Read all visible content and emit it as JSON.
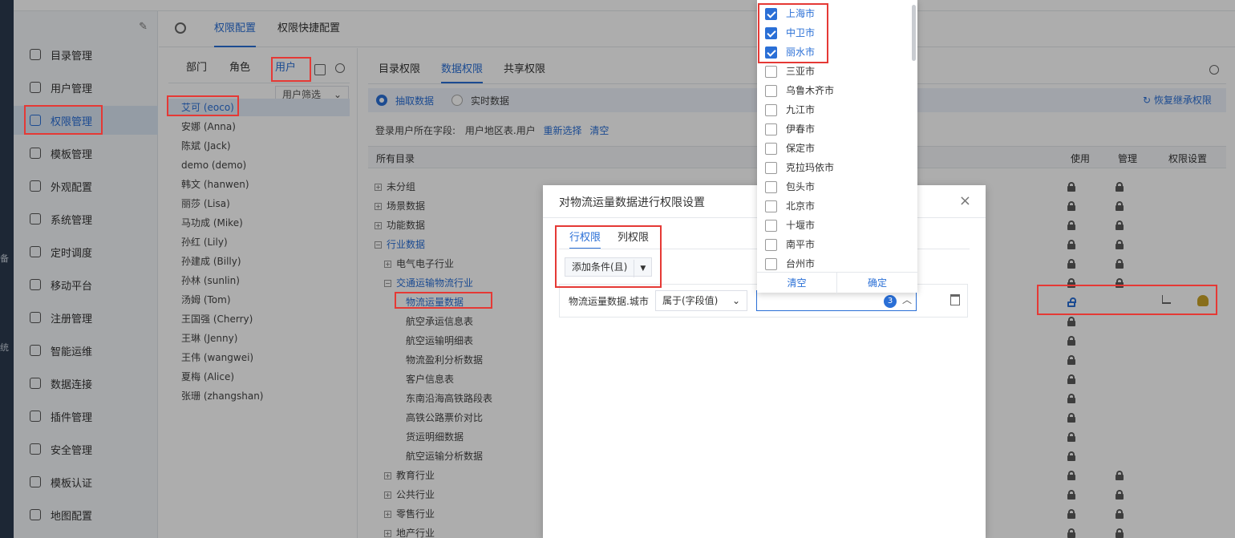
{
  "left_rail": {
    "fragments": [
      "备",
      "统"
    ]
  },
  "sidebar": {
    "pin_icon": "pin-icon",
    "items": [
      {
        "label": "目录管理",
        "icon": "catalog-icon"
      },
      {
        "label": "用户管理",
        "icon": "user-icon"
      },
      {
        "label": "权限管理",
        "icon": "lock-icon",
        "active": true
      },
      {
        "label": "模板管理",
        "icon": "template-icon"
      },
      {
        "label": "外观配置",
        "icon": "appearance-icon"
      },
      {
        "label": "系统管理",
        "icon": "gear-icon"
      },
      {
        "label": "定时调度",
        "icon": "clock-icon"
      },
      {
        "label": "移动平台",
        "icon": "mobile-icon"
      },
      {
        "label": "注册管理",
        "icon": "register-icon"
      },
      {
        "label": "智能运维",
        "icon": "ops-icon"
      },
      {
        "label": "数据连接",
        "icon": "link-icon"
      },
      {
        "label": "插件管理",
        "icon": "plugin-icon"
      },
      {
        "label": "安全管理",
        "icon": "shield-icon"
      },
      {
        "label": "模板认证",
        "icon": "cert-icon"
      },
      {
        "label": "地图配置",
        "icon": "map-icon"
      }
    ]
  },
  "header": {
    "tabs": [
      "权限配置",
      "权限快捷配置"
    ],
    "active_tab": 0
  },
  "user_panel": {
    "tabs": [
      "部门",
      "角色",
      "用户"
    ],
    "active_tab": 2,
    "filter_label": "用户筛选",
    "users": [
      "艾可 (eoco)",
      "安娜 (Anna)",
      "陈斌 (Jack)",
      "demo (demo)",
      "韩文 (hanwen)",
      "丽莎 (Lisa)",
      "马功成 (Mike)",
      "孙红 (Lily)",
      "孙建成 (Billy)",
      "孙林 (sunlin)",
      "汤姆 (Tom)",
      "王国强 (Cherry)",
      "王琳 (Jenny)",
      "王伟 (wangwei)",
      "夏梅 (Alice)",
      "张珊 (zhangshan)"
    ],
    "selected_user": 0
  },
  "main_panel": {
    "tabs": [
      "目录权限",
      "数据权限",
      "共享权限"
    ],
    "active_tab": 1,
    "modes": [
      "抽取数据",
      "实时数据"
    ],
    "active_mode": 0,
    "restore_label": "恢复继承权限",
    "login_field_label": "登录用户所在字段:",
    "login_field_value": "用户地区表.用户",
    "reselect_label": "重新选择",
    "clear_label": "清空",
    "table_header": {
      "catalog": "所有目录",
      "use": "使用",
      "manage": "管理",
      "perm_settings": "权限设置"
    },
    "tree": [
      {
        "label": "未分组",
        "level": 0,
        "expand": "+",
        "use": "lock",
        "manage": "lock"
      },
      {
        "label": "场景数据",
        "level": 0,
        "expand": "+",
        "use": "lock",
        "manage": "lock"
      },
      {
        "label": "功能数据",
        "level": 0,
        "expand": "+",
        "use": "lock",
        "manage": "lock"
      },
      {
        "label": "行业数据",
        "level": 0,
        "expand": "-",
        "use": "lock",
        "manage": "lock"
      },
      {
        "label": "电气电子行业",
        "level": 1,
        "expand": "+",
        "use": "lock",
        "manage": "lock"
      },
      {
        "label": "交通运输物流行业",
        "level": 1,
        "expand": "-",
        "use": "lock",
        "manage": "lock"
      },
      {
        "label": "物流运量数据",
        "level": 2,
        "expand": "",
        "use": "unlock",
        "manage": "",
        "selected": true
      },
      {
        "label": "航空承运信息表",
        "level": 2,
        "expand": "",
        "use": "lock",
        "manage": ""
      },
      {
        "label": "航空运输明细表",
        "level": 2,
        "expand": "",
        "use": "lock",
        "manage": ""
      },
      {
        "label": "物流盈利分析数据",
        "level": 2,
        "expand": "",
        "use": "lock",
        "manage": ""
      },
      {
        "label": "客户信息表",
        "level": 2,
        "expand": "",
        "use": "lock",
        "manage": ""
      },
      {
        "label": "东南沿海高铁路段表",
        "level": 2,
        "expand": "",
        "use": "lock",
        "manage": ""
      },
      {
        "label": "高铁公路票价对比",
        "level": 2,
        "expand": "",
        "use": "lock",
        "manage": ""
      },
      {
        "label": "货运明细数据",
        "level": 2,
        "expand": "",
        "use": "lock",
        "manage": ""
      },
      {
        "label": "航空运输分析数据",
        "level": 2,
        "expand": "",
        "use": "lock",
        "manage": ""
      },
      {
        "label": "教育行业",
        "level": 1,
        "expand": "+",
        "use": "lock",
        "manage": "lock"
      },
      {
        "label": "公共行业",
        "level": 1,
        "expand": "+",
        "use": "lock",
        "manage": "lock"
      },
      {
        "label": "零售行业",
        "level": 1,
        "expand": "+",
        "use": "lock",
        "manage": "lock"
      },
      {
        "label": "地产行业",
        "level": 1,
        "expand": "+",
        "use": "lock",
        "manage": "lock"
      }
    ]
  },
  "modal": {
    "title": "对物流运量数据进行权限设置",
    "tabs": [
      "行权限",
      "列权限"
    ],
    "active_tab": 0,
    "add_condition_label": "添加条件(且)",
    "condition": {
      "field": "物流运量数据.城市",
      "operator": "属于(字段值)",
      "selected_count": "3"
    }
  },
  "city_dropdown": {
    "cities": [
      {
        "name": "上海市",
        "checked": true
      },
      {
        "name": "中卫市",
        "checked": true
      },
      {
        "name": "丽水市",
        "checked": true
      },
      {
        "name": "三亚市",
        "checked": false
      },
      {
        "name": "乌鲁木齐市",
        "checked": false
      },
      {
        "name": "九江市",
        "checked": false
      },
      {
        "name": "伊春市",
        "checked": false
      },
      {
        "name": "保定市",
        "checked": false
      },
      {
        "name": "克拉玛依市",
        "checked": false
      },
      {
        "name": "包头市",
        "checked": false
      },
      {
        "name": "北京市",
        "checked": false
      },
      {
        "name": "十堰市",
        "checked": false
      },
      {
        "name": "南平市",
        "checked": false
      },
      {
        "name": "台州市",
        "checked": false
      }
    ],
    "clear_label": "清空",
    "confirm_label": "确定"
  },
  "colors": {
    "accent": "#2a6fd6",
    "highlight": "#e53935",
    "sidebar_bg": "#f4f6f9",
    "rail": "#2b3a4e"
  }
}
